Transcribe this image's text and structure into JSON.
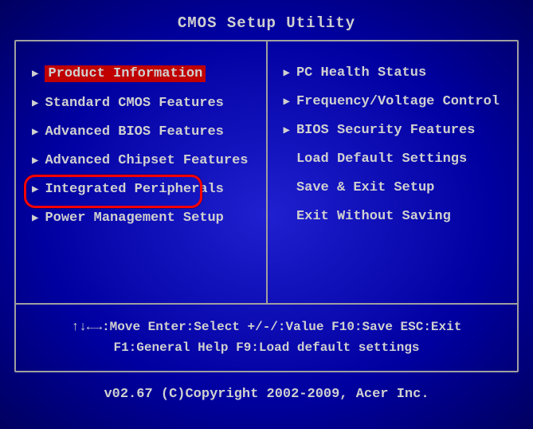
{
  "title": "CMOS Setup Utility",
  "menu": {
    "left": [
      {
        "label": "Product Information",
        "hasArrow": true,
        "selected": true,
        "circled": false
      },
      {
        "label": "Standard CMOS Features",
        "hasArrow": true,
        "selected": false,
        "circled": false
      },
      {
        "label": "Advanced BIOS Features",
        "hasArrow": true,
        "selected": false,
        "circled": false
      },
      {
        "label": "Advanced Chipset Features",
        "hasArrow": true,
        "selected": false,
        "circled": false
      },
      {
        "label": "Integrated Peripherals",
        "hasArrow": true,
        "selected": false,
        "circled": true
      },
      {
        "label": "Power Management Setup",
        "hasArrow": true,
        "selected": false,
        "circled": false
      }
    ],
    "right": [
      {
        "label": "PC Health Status",
        "hasArrow": true,
        "selected": false,
        "circled": false
      },
      {
        "label": "Frequency/Voltage Control",
        "hasArrow": true,
        "selected": false,
        "circled": false
      },
      {
        "label": "BIOS Security Features",
        "hasArrow": true,
        "selected": false,
        "circled": false
      },
      {
        "label": "Load Default Settings",
        "hasArrow": false,
        "selected": false,
        "circled": false
      },
      {
        "label": "Save & Exit Setup",
        "hasArrow": false,
        "selected": false,
        "circled": false
      },
      {
        "label": "Exit Without Saving",
        "hasArrow": false,
        "selected": false,
        "circled": false
      }
    ]
  },
  "help": {
    "line1": "↑↓←→:Move  Enter:Select   +/-/:Value  F10:Save  ESC:Exit",
    "line2": "F1:General Help          F9:Load default settings"
  },
  "footer": "v02.67 (C)Copyright 2002-2009, Acer Inc."
}
